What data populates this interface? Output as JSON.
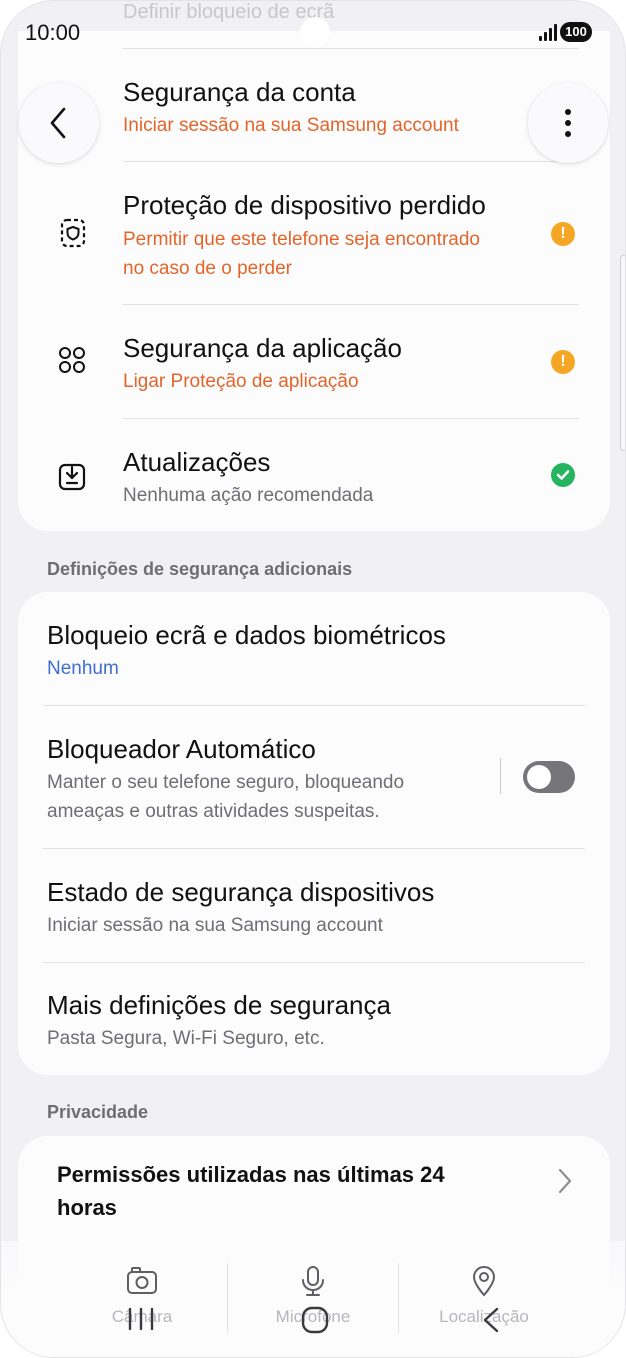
{
  "status_bar": {
    "time": "10:00",
    "battery": "100"
  },
  "faded_top_text": "Definir bloqueio de ecrã",
  "protection_items": [
    {
      "title": "Segurança da conta",
      "subtitle": "Iniciar sessão na sua Samsung account",
      "icon": "account-icon"
    },
    {
      "title": "Proteção de dispositivo perdido",
      "subtitle_line1": "Permitir que este telefone seja encontrado",
      "subtitle_line2": "no caso de o perder",
      "icon": "lost-device-icon",
      "status": "warning"
    },
    {
      "title": "Segurança da aplicação",
      "subtitle": "Ligar Proteção de aplicação",
      "icon": "app-security-icon",
      "status": "warning"
    },
    {
      "title": "Atualizações",
      "subtitle": "Nenhuma ação recomendada",
      "icon": "updates-icon",
      "status": "ok"
    }
  ],
  "additional_section": {
    "header": "Definições de segurança adicionais",
    "items": [
      {
        "title": "Bloqueio ecrã e dados biométricos",
        "subtitle": "Nenhum"
      },
      {
        "title": "Bloqueador Automático",
        "subtitle_line1": "Manter o seu telefone seguro, bloqueando",
        "subtitle_line2": "ameaças e outras atividades suspeitas.",
        "toggle": "off"
      },
      {
        "title": "Estado de segurança dispositivos",
        "subtitle": "Iniciar sessão na sua Samsung account"
      },
      {
        "title": "Mais definições de segurança",
        "subtitle": "Pasta Segura, Wi-Fi Seguro, etc."
      }
    ]
  },
  "privacy_section": {
    "header": "Privacidade",
    "item_line1": "Permissões utilizadas nas últimas 24",
    "item_line2": "horas"
  },
  "bottom_bar": [
    {
      "label": "Câmara",
      "icon": "camera-icon"
    },
    {
      "label": "Microfone",
      "icon": "microphone-icon"
    },
    {
      "label": "Localização",
      "icon": "location-icon"
    }
  ],
  "colors": {
    "warning": "#f5a623",
    "ok": "#27b45f",
    "accent_orange": "#e2652a",
    "link_blue": "#3e6fd0"
  }
}
